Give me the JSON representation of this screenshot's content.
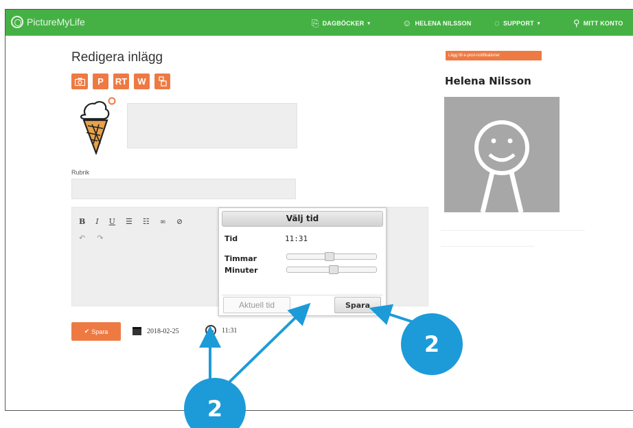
{
  "nav": {
    "logo": "PictureMyLife",
    "items": [
      {
        "icon": "diary-icon",
        "label": "DAGBÖCKER"
      },
      {
        "icon": "user-circle-icon",
        "label": "HELENA NILSSON"
      },
      {
        "icon": "speech-bubble-icon",
        "label": "SUPPORT"
      },
      {
        "icon": "account-icon",
        "label": "MITT KONTO"
      }
    ],
    "color": "#45b145"
  },
  "page": {
    "title": "Redigera inlägg",
    "tool_buttons": [
      {
        "icon": "camera-icon",
        "label": ""
      },
      {
        "icon": "p-icon",
        "label": "P"
      },
      {
        "icon": "rt-icon",
        "label": "RT"
      },
      {
        "icon": "w-icon",
        "label": "W"
      },
      {
        "icon": "pictogram-icon",
        "label": ""
      }
    ],
    "rubrik_label": "Rubrik",
    "save_label": "Spara",
    "date": "2018-02-25",
    "time": "11:31",
    "accent": "#ee7a43"
  },
  "picker": {
    "title": "Välj tid",
    "tid_label": "Tid",
    "tid_value": "11:31",
    "hours_label": "Timmar",
    "minutes_label": "Minuter",
    "hours_value": 11,
    "minutes_value": 31,
    "now_label": "Aktuell tid",
    "save_label": "Spara"
  },
  "sidebar": {
    "notification_button": "Lägg till e-post-notifikationer",
    "profile_name": "Helena Nilsson"
  },
  "annotations": {
    "badge_left": "2",
    "badge_right": "2",
    "color": "#1d9bd8"
  }
}
